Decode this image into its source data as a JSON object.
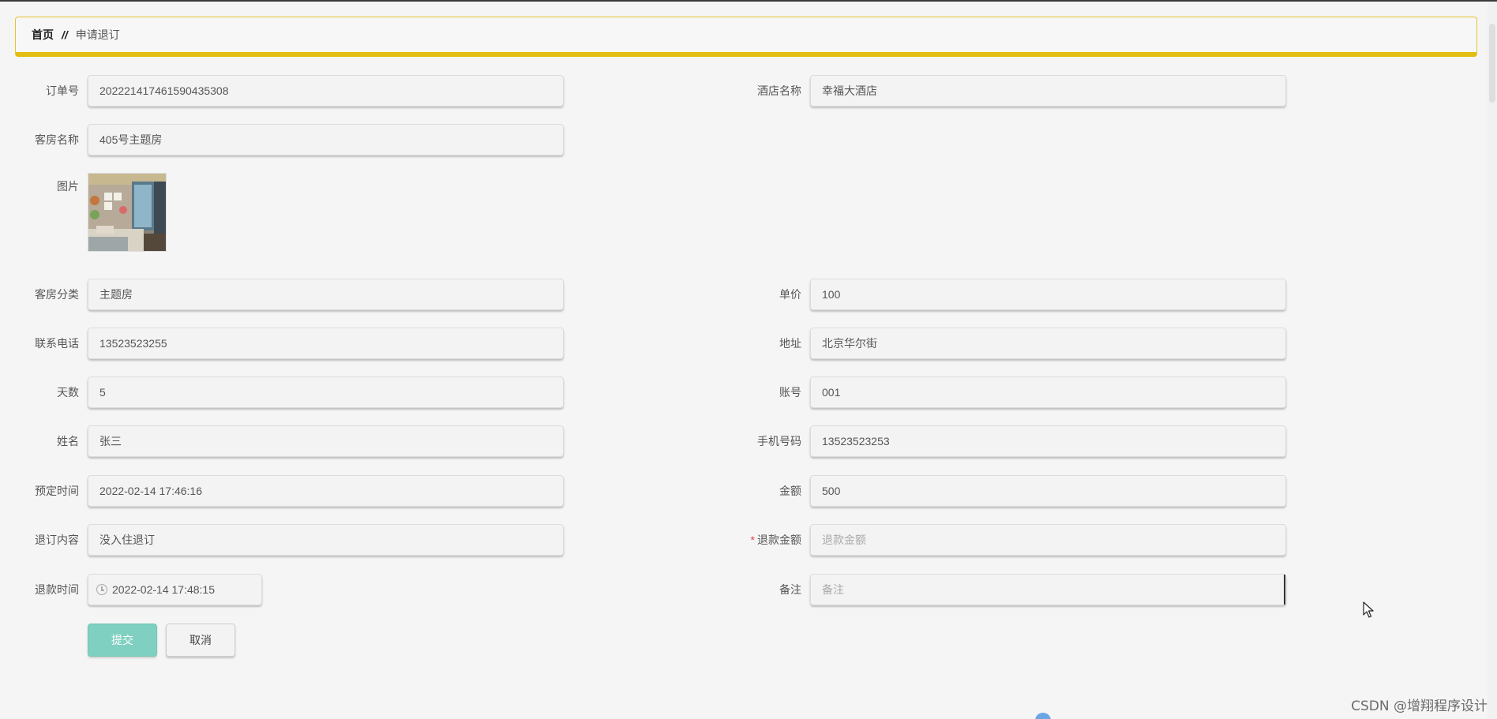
{
  "breadcrumb": {
    "home": "首页",
    "separator": "//",
    "current": "申请退订"
  },
  "form": {
    "order_no": {
      "label": "订单号",
      "value": "202221417461590435308"
    },
    "hotel_name": {
      "label": "酒店名称",
      "value": "幸福大酒店"
    },
    "room_name": {
      "label": "客房名称",
      "value": "405号主题房"
    },
    "image": {
      "label": "图片"
    },
    "room_category": {
      "label": "客房分类",
      "value": "主题房"
    },
    "unit_price": {
      "label": "单价",
      "value": "100"
    },
    "phone": {
      "label": "联系电话",
      "value": "13523523255"
    },
    "address": {
      "label": "地址",
      "value": "北京华尔街"
    },
    "days": {
      "label": "天数",
      "value": "5"
    },
    "account": {
      "label": "账号",
      "value": "001"
    },
    "name": {
      "label": "姓名",
      "value": "张三"
    },
    "mobile": {
      "label": "手机号码",
      "value": "13523523253"
    },
    "booking_time": {
      "label": "预定时间",
      "value": "2022-02-14 17:46:16"
    },
    "amount": {
      "label": "金额",
      "value": "500"
    },
    "cancel_content": {
      "label": "退订内容",
      "value": "没入住退订"
    },
    "refund_amount": {
      "label": "退款金额",
      "required_mark": "*",
      "value": "",
      "placeholder": "退款金额"
    },
    "refund_time": {
      "label": "退款时间",
      "value": "2022-02-14 17:48:15"
    },
    "remark": {
      "label": "备注",
      "value": "",
      "placeholder": "备注"
    }
  },
  "buttons": {
    "submit": "提交",
    "cancel": "取消"
  },
  "watermark": "CSDN @增翔程序设计",
  "colors": {
    "accent_yellow": "#e1be10",
    "submit_button": "#7fd0c0",
    "required": "#e53c3c"
  },
  "icons": {
    "time": "clock-icon",
    "cursor": "mouse-pointer-icon"
  }
}
